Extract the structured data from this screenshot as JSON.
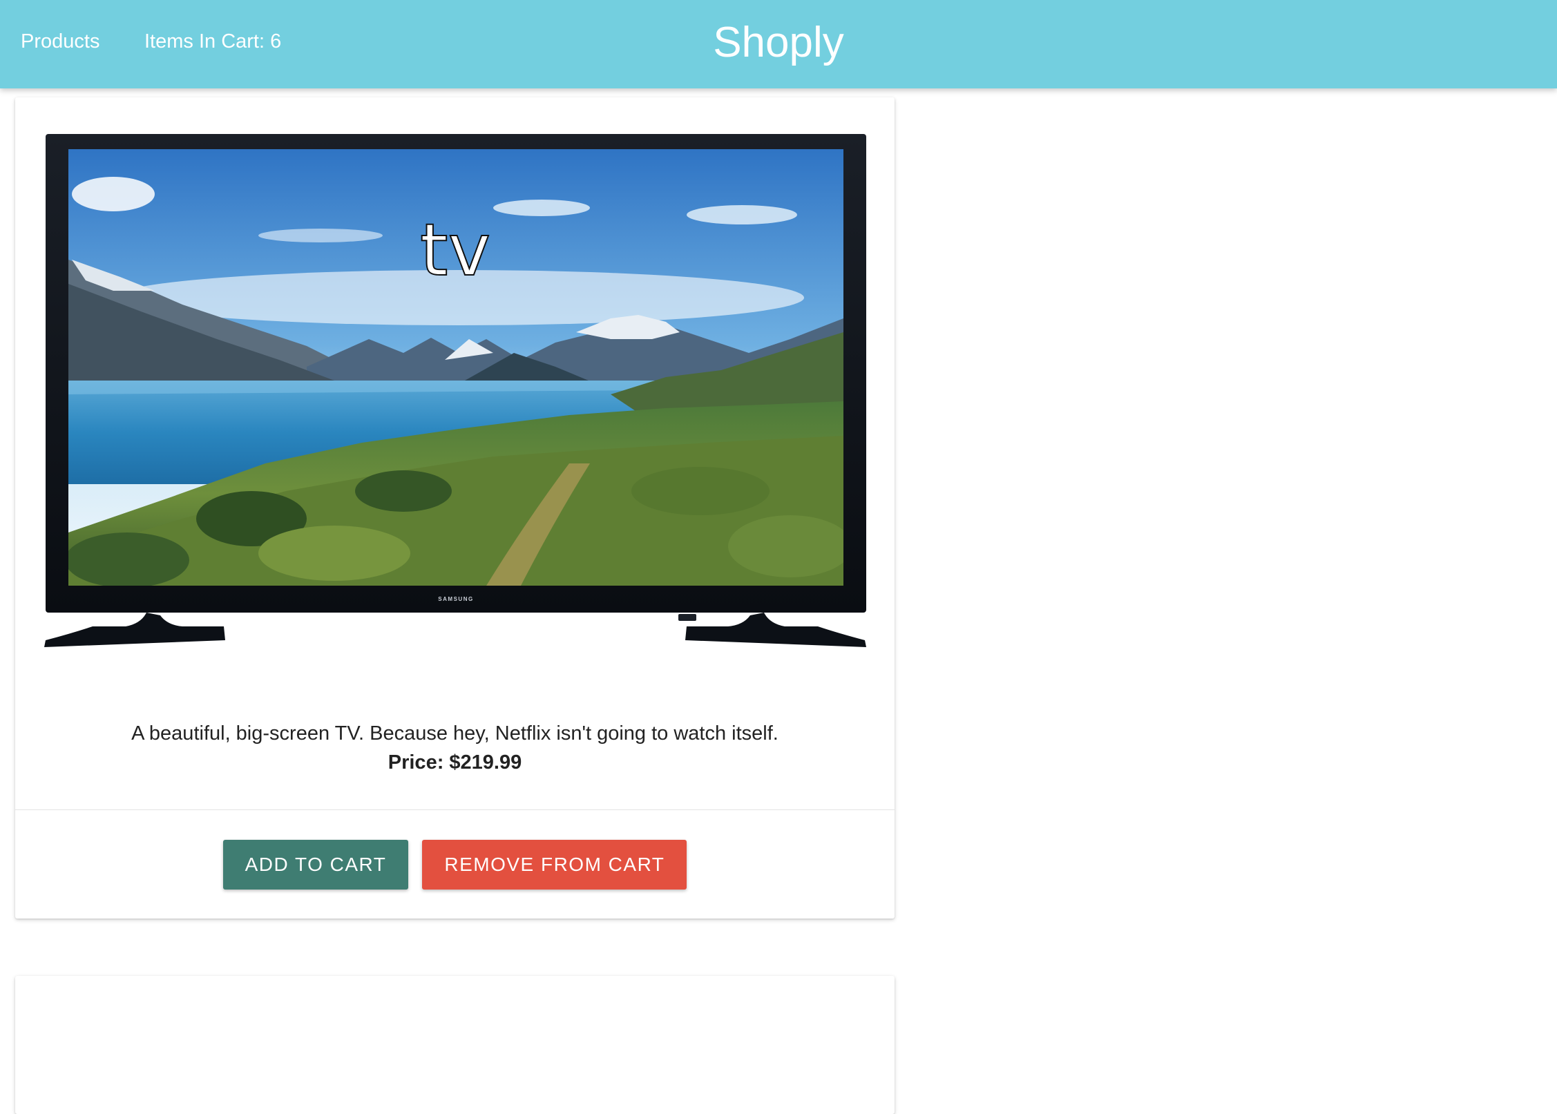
{
  "navbar": {
    "products_link": "Products",
    "cart_link": "Items In Cart: 6",
    "brand": "Shoply",
    "background_color": "#73cfdf"
  },
  "product": {
    "image_title": "tv",
    "image_caption": "SAMSUNG",
    "description": "A beautiful, big-screen TV. Because hey, Netflix isn't going to watch itself.",
    "price_text": "Price: $219.99",
    "add_button": "ADD TO CART",
    "remove_button": "REMOVE FROM CART",
    "add_button_color": "#3f7d72",
    "remove_button_color": "#e3503f"
  }
}
